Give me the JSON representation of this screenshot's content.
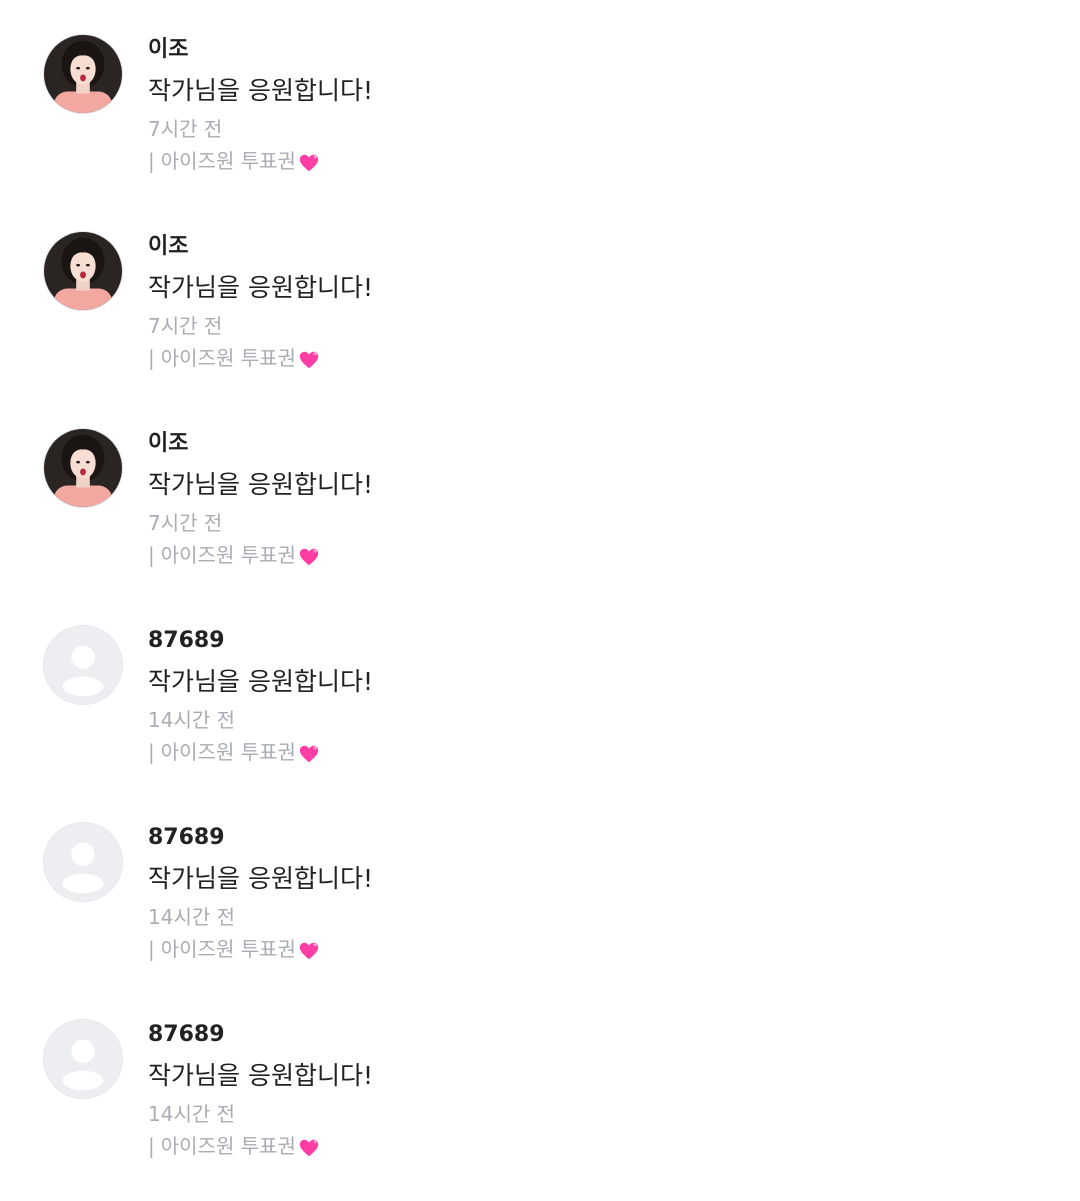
{
  "colors": {
    "author_text": "#222222",
    "body_text": "#222222",
    "meta_text": "#a9adb3",
    "heart": "#ff3ea5",
    "default_avatar_bg": "#eceef1",
    "default_avatar_fg": "#ffffff"
  },
  "comments": [
    {
      "author": "이조",
      "avatar": "photo-avatar",
      "text": "작가님을 응원합니다!",
      "time": "7시간 전",
      "separator": "|",
      "badge": "아이즈원 투표권",
      "badge_icon": "pink-heart-icon"
    },
    {
      "author": "이조",
      "avatar": "photo-avatar",
      "text": "작가님을 응원합니다!",
      "time": "7시간 전",
      "separator": "|",
      "badge": "아이즈원 투표권",
      "badge_icon": "pink-heart-icon"
    },
    {
      "author": "이조",
      "avatar": "photo-avatar",
      "text": "작가님을 응원합니다!",
      "time": "7시간 전",
      "separator": "|",
      "badge": "아이즈원 투표권",
      "badge_icon": "pink-heart-icon"
    },
    {
      "author": "87689",
      "avatar": "default-user-avatar",
      "text": "작가님을 응원합니다!",
      "time": "14시간 전",
      "separator": "|",
      "badge": "아이즈원 투표권",
      "badge_icon": "pink-heart-icon"
    },
    {
      "author": "87689",
      "avatar": "default-user-avatar",
      "text": "작가님을 응원합니다!",
      "time": "14시간 전",
      "separator": "|",
      "badge": "아이즈원 투표권",
      "badge_icon": "pink-heart-icon"
    },
    {
      "author": "87689",
      "avatar": "default-user-avatar",
      "text": "작가님을 응원합니다!",
      "time": "14시간 전",
      "separator": "|",
      "badge": "아이즈원 투표권",
      "badge_icon": "pink-heart-icon"
    }
  ]
}
